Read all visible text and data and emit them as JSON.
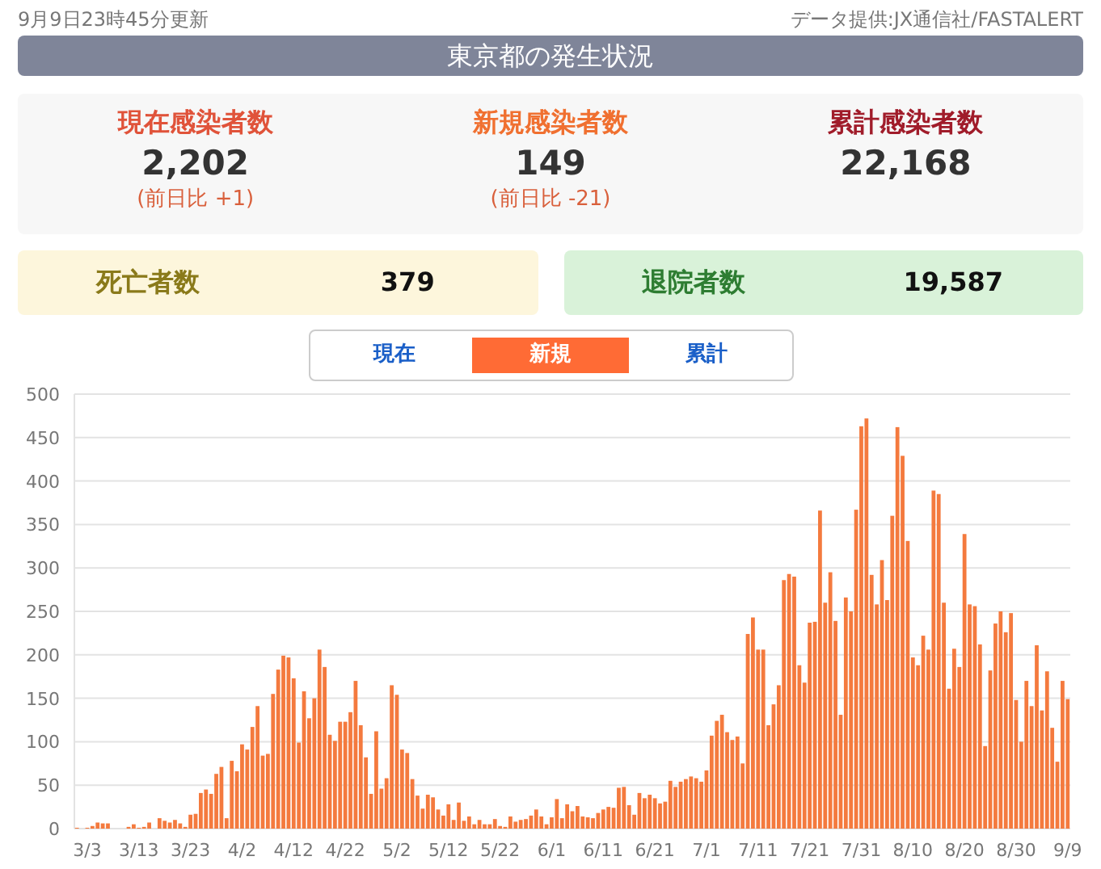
{
  "updated": "9月9日23時45分更新",
  "source": "データ提供:JX通信社/FASTALERT",
  "title": "東京都の発生状況",
  "stats": [
    {
      "kind": "current",
      "label": "現在感染者数",
      "value": "2,202",
      "diff": "(前日比 +1)"
    },
    {
      "kind": "new",
      "label": "新規感染者数",
      "value": "149",
      "diff": "(前日比 -21)"
    },
    {
      "kind": "total",
      "label": "累計感染者数",
      "value": "22,168"
    }
  ],
  "summary": [
    {
      "kind": "deaths",
      "label": "死亡者数",
      "value": "379"
    },
    {
      "kind": "discharged",
      "label": "退院者数",
      "value": "19,587"
    }
  ],
  "tabs": [
    {
      "label": "現在",
      "selected": false
    },
    {
      "label": "新規",
      "selected": true
    },
    {
      "label": "累計",
      "selected": false
    }
  ],
  "chart_data": {
    "type": "bar",
    "ylim": [
      0,
      500
    ],
    "yticks": [
      0,
      50,
      100,
      150,
      200,
      250,
      300,
      350,
      400,
      450,
      500
    ],
    "grid": true,
    "categories": [
      null,
      null,
      "3/3",
      null,
      null,
      null,
      null,
      null,
      null,
      null,
      null,
      null,
      "3/13",
      null,
      null,
      null,
      null,
      null,
      null,
      null,
      null,
      null,
      "3/23",
      null,
      null,
      null,
      null,
      null,
      null,
      null,
      null,
      null,
      "4/2",
      null,
      null,
      null,
      null,
      null,
      null,
      null,
      null,
      null,
      "4/12",
      null,
      null,
      null,
      null,
      null,
      null,
      null,
      null,
      null,
      "4/22",
      null,
      null,
      null,
      null,
      null,
      null,
      null,
      null,
      null,
      "5/2",
      null,
      null,
      null,
      null,
      null,
      null,
      null,
      null,
      null,
      "5/12",
      null,
      null,
      null,
      null,
      null,
      null,
      null,
      null,
      null,
      "5/22",
      null,
      null,
      null,
      null,
      null,
      null,
      null,
      null,
      null,
      "6/1",
      null,
      null,
      null,
      null,
      null,
      null,
      null,
      null,
      null,
      "6/11",
      null,
      null,
      null,
      null,
      null,
      null,
      null,
      null,
      null,
      "6/21",
      null,
      null,
      null,
      null,
      null,
      null,
      null,
      null,
      null,
      "7/1",
      null,
      null,
      null,
      null,
      null,
      null,
      null,
      null,
      null,
      "7/11",
      null,
      null,
      null,
      null,
      null,
      null,
      null,
      null,
      null,
      "7/21",
      null,
      null,
      null,
      null,
      null,
      null,
      null,
      null,
      null,
      "7/31",
      null,
      null,
      null,
      null,
      null,
      null,
      null,
      null,
      null,
      "8/10",
      null,
      null,
      null,
      null,
      null,
      null,
      null,
      null,
      null,
      "8/20",
      null,
      null,
      null,
      null,
      null,
      null,
      null,
      null,
      null,
      "8/30",
      null,
      null,
      null,
      null,
      null,
      null,
      null,
      null,
      null,
      "9/9"
    ],
    "series": [
      {
        "color": "#f47a3e",
        "values": [
          1,
          0,
          1,
          3,
          7,
          6,
          6,
          0,
          0,
          0,
          2,
          5,
          1,
          2,
          7,
          0,
          12,
          9,
          7,
          10,
          6,
          2,
          16,
          17,
          41,
          45,
          40,
          63,
          71,
          12,
          78,
          66,
          97,
          91,
          117,
          141,
          84,
          86,
          155,
          183,
          199,
          197,
          173,
          99,
          158,
          127,
          150,
          206,
          186,
          108,
          101,
          123,
          123,
          134,
          170,
          119,
          82,
          40,
          112,
          46,
          58,
          165,
          154,
          91,
          87,
          57,
          38,
          23,
          39,
          36,
          22,
          15,
          28,
          10,
          30,
          9,
          14,
          5,
          10,
          5,
          5,
          11,
          3,
          2,
          14,
          8,
          10,
          11,
          15,
          22,
          14,
          5,
          13,
          34,
          12,
          28,
          20,
          26,
          14,
          13,
          12,
          18,
          22,
          25,
          24,
          47,
          48,
          27,
          16,
          41,
          35,
          39,
          35,
          29,
          31,
          55,
          48,
          54,
          57,
          60,
          58,
          54,
          67,
          107,
          124,
          131,
          111,
          102,
          106,
          75,
          224,
          243,
          206,
          206,
          119,
          143,
          165,
          286,
          293,
          290,
          188,
          168,
          237,
          238,
          366,
          260,
          295,
          239,
          131,
          266,
          250,
          367,
          463,
          472,
          292,
          258,
          309,
          263,
          360,
          462,
          429,
          331,
          197,
          188,
          222,
          206,
          389,
          385,
          260,
          161,
          207,
          186,
          339,
          258,
          256,
          212,
          95,
          182,
          236,
          250,
          226,
          248,
          148,
          100,
          170,
          141,
          211,
          136,
          181,
          116,
          77,
          170,
          149
        ]
      }
    ]
  }
}
